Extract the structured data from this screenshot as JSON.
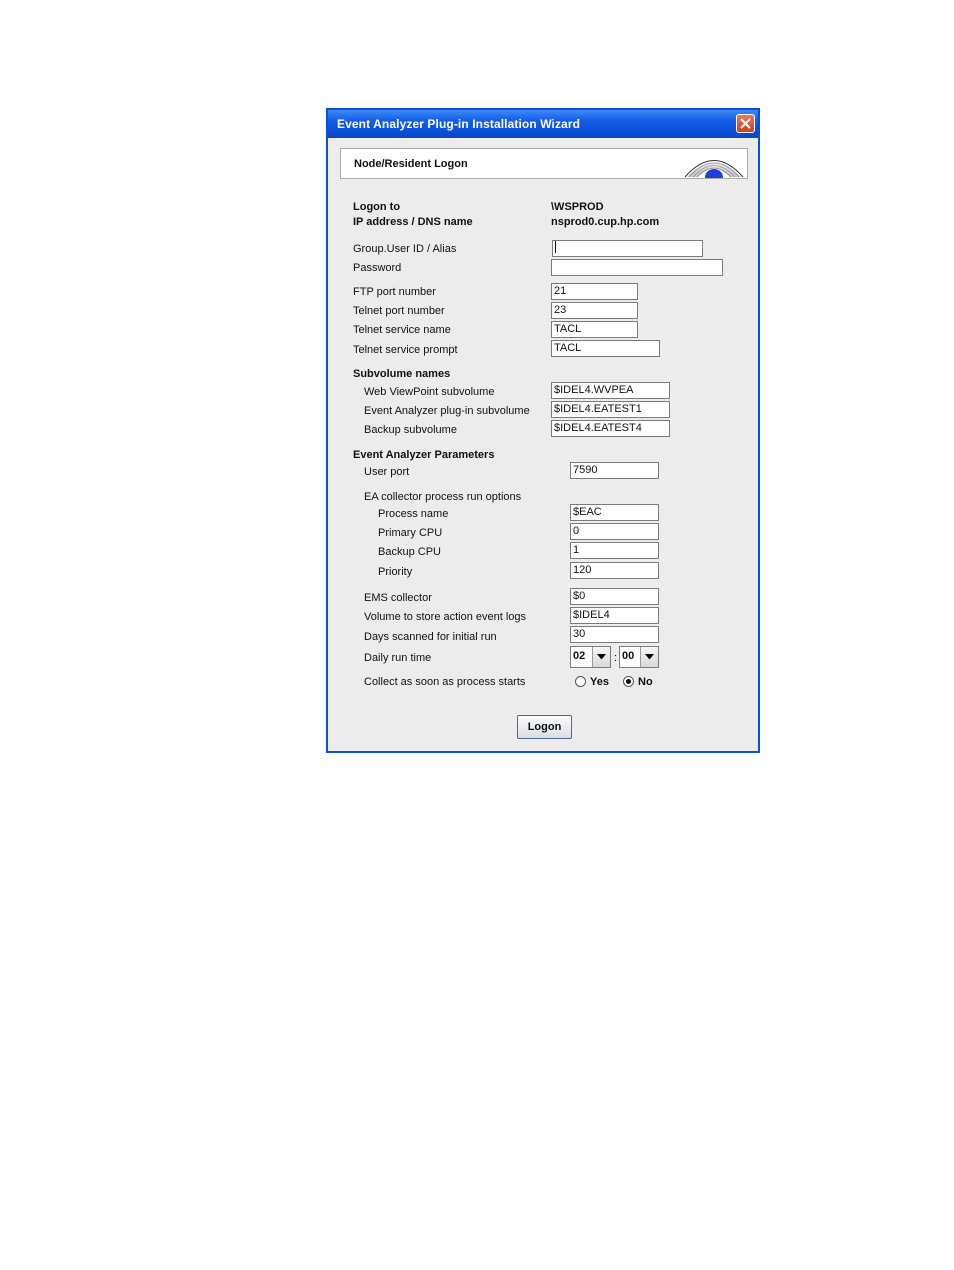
{
  "window": {
    "title": "Event Analyzer Plug-in Installation Wizard"
  },
  "header": {
    "title": "Node/Resident Logon"
  },
  "logon": {
    "logon_to_label": "Logon to",
    "logon_to_value": "\\WSPROD",
    "ip_label": "IP address / DNS name",
    "ip_value": "nsprod0.cup.hp.com"
  },
  "credentials": {
    "user_label": "Group.User ID / Alias",
    "user_value": "",
    "password_label": "Password",
    "password_value": ""
  },
  "ports": {
    "ftp_label": "FTP port number",
    "ftp_value": "21",
    "telnet_label": "Telnet port number",
    "telnet_value": "23",
    "service_name_label": "Telnet service name",
    "service_name_value": "TACL",
    "service_prompt_label": "Telnet service prompt",
    "service_prompt_value": "TACL"
  },
  "subvolumes": {
    "heading": "Subvolume names",
    "webvp_label": "Web ViewPoint subvolume",
    "webvp_value": "$IDEL4.WVPEA",
    "plugin_label": "Event Analyzer plug-in subvolume",
    "plugin_value": "$IDEL4.EATEST1",
    "backup_label": "Backup subvolume",
    "backup_value": "$IDEL4.EATEST4"
  },
  "params": {
    "heading": "Event Analyzer Parameters",
    "user_port_label": "User port",
    "user_port_value": "7590",
    "collector_heading": "EA collector process run options",
    "process_name_label": "Process name",
    "process_name_value": "$EAC",
    "primary_cpu_label": "Primary CPU",
    "primary_cpu_value": "0",
    "backup_cpu_label": "Backup CPU",
    "backup_cpu_value": "1",
    "priority_label": "Priority",
    "priority_value": "120",
    "ems_label": "EMS collector",
    "ems_value": "$0",
    "volume_label": "Volume to store action event logs",
    "volume_value": "$IDEL4",
    "days_label": "Days scanned for initial run",
    "days_value": "30",
    "run_time_label": "Daily run time",
    "run_time_hour": "02",
    "run_time_sep": ":",
    "run_time_minute": "00",
    "collect_label": "Collect as soon as process starts",
    "collect_yes": "Yes",
    "collect_no": "No",
    "collect_selected": "No"
  },
  "buttons": {
    "logon": "Logon"
  },
  "colors": {
    "title_bar": "#0a4fd8",
    "close_button": "#c8431f",
    "dialog_bg": "#ececec"
  }
}
